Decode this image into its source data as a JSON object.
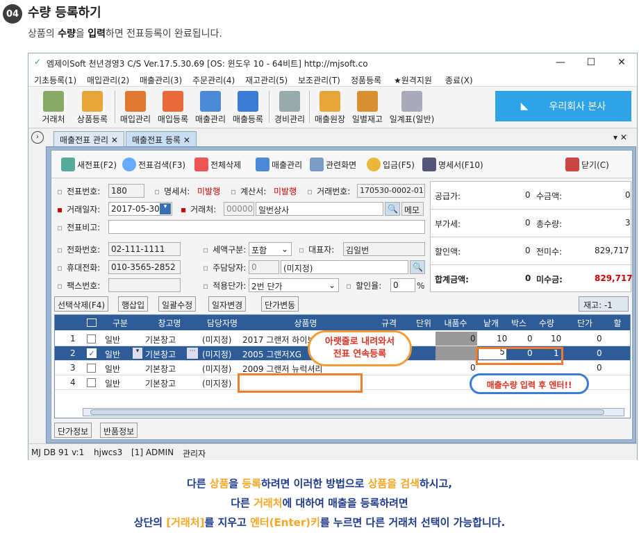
{
  "step": {
    "badge": "04",
    "title": "수량 등록하기",
    "desc_pre": "상품의 ",
    "desc_b1": "수량",
    "desc_mid": "을 ",
    "desc_b2": "입력",
    "desc_post": "하면 전표등록이 완료됩니다."
  },
  "window": {
    "title": "엠제이Soft 천년경영3 C/S    Ver.17.5.30.69    [OS: 윈도우 10 - 64비트]    http://mjsoft.co",
    "min": "—",
    "max": "☐",
    "close": "✕"
  },
  "menu": [
    "기초등록(1)",
    "매입관리(2)",
    "매출관리(3)",
    "주문관리(4)",
    "재고관리(5)",
    "보조관리(T)",
    "정품등록",
    "★원격지원",
    "종료(X)"
  ],
  "toolbar": [
    "거래처",
    "상품등록",
    "매입관리",
    "매입등록",
    "매출관리",
    "매출등록",
    "경비관리",
    "매출원장",
    "일별재고",
    "일계표(일반)"
  ],
  "brand": "우리회사 본사",
  "tabs": [
    "매출전표 관리",
    "매출전표 등록"
  ],
  "actions": [
    "새전표(F2)",
    "전표검색(F3)",
    "전체삭제",
    "매출관리",
    "관련화면",
    "입금(F5)",
    "명세서(F10)",
    "닫기(C)"
  ],
  "form": {
    "slip_no_label": "전표번호:",
    "slip_no": "180",
    "stmt_label": "명세서:",
    "stmt": "미발행",
    "tax_label": "계산서:",
    "tax": "미발행",
    "trade_no_label": "거래번호:",
    "trade_no": "170530-0002-01",
    "date_label": "거래일자:",
    "date": "2017-05-30",
    "client_label": "거래처:",
    "client_code": "000001",
    "client": "일번상사",
    "memo": "메모",
    "note_label": "전표비고:",
    "phone_label": "전화번호:",
    "phone": "02-111-1111",
    "taxtype_label": "세액구분:",
    "taxtype": "포함",
    "ceo_label": "대표자:",
    "ceo": "김일번",
    "mobile_label": "휴대전화:",
    "mobile": "010-3565-2852",
    "manager_label": "주담당자:",
    "manager_code": "0",
    "manager": "(미지정)",
    "fax_label": "팩스번호:",
    "price_label": "적용단가:",
    "price": "2번 단가",
    "disc_label": "할인율:",
    "disc": "0",
    "pct": "%"
  },
  "summary": [
    [
      "공급가:",
      "0",
      "수금액:",
      "0"
    ],
    [
      "부가세:",
      "0",
      "총수량:",
      "3"
    ],
    [
      "할인액:",
      "0",
      "전미수:",
      "829,717"
    ],
    [
      "합계금액:",
      "0",
      "미수금:",
      "829,717"
    ]
  ],
  "gridbtns": [
    "선택삭제(F4)",
    "행삽입",
    "일괄수정",
    "일자변경",
    "단가변동"
  ],
  "stock": "재고: -1",
  "grid": {
    "headers": [
      "구분",
      "창고명",
      "담당자명",
      "상품명",
      "규격",
      "단위",
      "내품수",
      "낱개",
      "박스",
      "수량",
      "단가",
      "할"
    ],
    "rows": [
      [
        "1",
        "",
        "일반",
        "기본창고",
        "(미지정)",
        "2017 그랜저 하이브",
        "",
        "",
        "0",
        "10",
        "0",
        "10",
        "0"
      ],
      [
        "2",
        "✓",
        "일반",
        "기본창고",
        "(미지정)",
        "2005 그랜저XG",
        "",
        "",
        "",
        "5",
        "0",
        "1",
        "0"
      ],
      [
        "3",
        "",
        "일반",
        "기본창고",
        "(미지정)",
        "2009 그랜저 뉴럭셔리",
        "",
        "",
        "0",
        "",
        "",
        "",
        "0"
      ],
      [
        "4",
        "",
        "일반",
        "기본창고",
        "(미지정)",
        "",
        "",
        "",
        "",
        "",
        "",
        "",
        ""
      ]
    ]
  },
  "bottomtabs": [
    "단가정보",
    "반품정보"
  ],
  "status": [
    "MJ DB 91 v:1",
    "hjwcs3",
    "[1] ADMIN",
    "관리자"
  ],
  "callout1": [
    "아랫줄로 내려와서",
    "전표 연속등록"
  ],
  "callout2": "매출수량 입력 후 엔터!!",
  "footer": {
    "l1a": "다른 ",
    "l1b": "상품",
    "l1c": "을 ",
    "l1d": "등록",
    "l1e": "하려면 이러한 방법으로 ",
    "l1f": "상품을 검색",
    "l1g": "하시고,",
    "l2a": "다른 ",
    "l2b": "거래처",
    "l2c": "에 대하여 매출을 등록하려면",
    "l3a": "상단의 ",
    "l3b": "[거래처]",
    "l3c": "를 지우고 ",
    "l3d": "엔터(Enter)키",
    "l3e": "를 누르면 다른 거래처 선택이 가능합니다."
  },
  "colors": {
    "accent": "#2d5c99",
    "brand": "#2ea3e6",
    "highlight": "#f07d2c"
  }
}
